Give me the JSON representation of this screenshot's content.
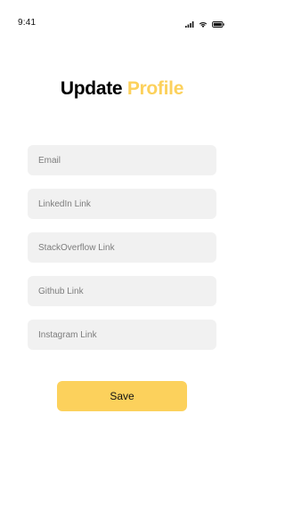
{
  "status_bar": {
    "time": "9:41"
  },
  "header": {
    "title_part1": "Update",
    "title_part2": "Profile"
  },
  "form": {
    "email_placeholder": "Email",
    "linkedin_placeholder": "LinkedIn Link",
    "stackoverflow_placeholder": "StackOverflow Link",
    "github_placeholder": "Github Link",
    "instagram_placeholder": "Instagram Link",
    "email_value": "",
    "linkedin_value": "",
    "stackoverflow_value": "",
    "github_value": "",
    "instagram_value": ""
  },
  "actions": {
    "save_label": "Save"
  },
  "colors": {
    "accent": "#FCD15C",
    "field_bg": "#F1F1F1",
    "title_dark": "#000000"
  },
  "icons": {
    "signal": "cellular-signal-icon",
    "wifi": "wifi-icon",
    "battery": "battery-icon"
  }
}
